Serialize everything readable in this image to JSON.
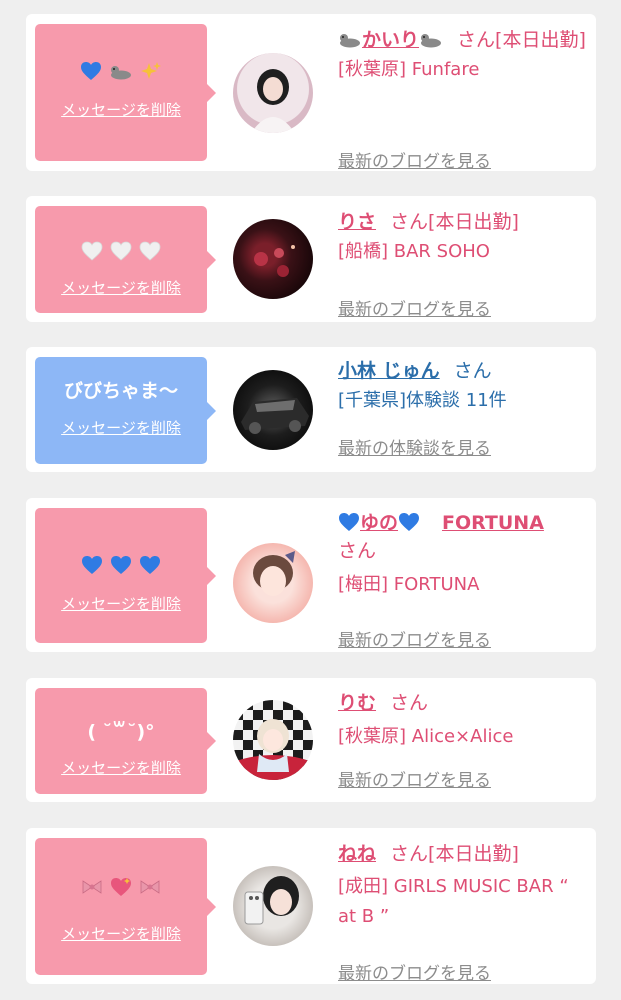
{
  "colors": {
    "pink_bubble": "#f79aac",
    "blue_bubble": "#8db7f6",
    "name_pink": "#de4e74",
    "name_blue": "#2b6eaa",
    "link_gray": "#8c8c8c",
    "heart_blue": "#2f7be3",
    "heart_white": "#f0f0f0",
    "heart_pink": "#e8567c"
  },
  "delete_label": "メッセージを削除",
  "entries": [
    {
      "message_icons": [
        "blue-heart-icon",
        "seal-icon",
        "sparkles-icon"
      ],
      "name": "かいり",
      "name_icons": [
        "seal-icon",
        "seal-icon"
      ],
      "san": "さん",
      "status": "[本日出勤]",
      "shop": "[秋葉原] Funfare",
      "link": "最新のブログを見る"
    },
    {
      "message_icons": [
        "white-heart-icon",
        "white-heart-icon",
        "white-heart-icon"
      ],
      "name": "りさ",
      "san": "さん",
      "status": "[本日出勤]",
      "shop": "[船橋] BAR SOHO",
      "link": "最新のブログを見る"
    },
    {
      "message": "びびちゃま〜",
      "name": "小林 じゅん",
      "san": "さん",
      "shop": "[千葉県]体験談 11件",
      "link": "最新の体験談を見る"
    },
    {
      "message_icons": [
        "blue-heart-icon",
        "blue-heart-icon",
        "blue-heart-icon"
      ],
      "name": "ゆの",
      "name_icons": [
        "blue-heart-icon",
        "blue-heart-icon"
      ],
      "name_suffix": "FORTUNA",
      "san": "さん",
      "shop": "[梅田] FORTUNA",
      "link": "最新のブログを見る"
    },
    {
      "message": "( ˘꒳˘)°",
      "name": "りむ",
      "san": "さん",
      "shop": "[秋葉原] Alice×Alice",
      "link": "最新のブログを見る"
    },
    {
      "message_icons": [
        "ribbon-icon",
        "sparkling-heart-icon",
        "ribbon-icon"
      ],
      "name": "ねね",
      "san": "さん",
      "status": "[本日出勤]",
      "shop": "[成田] GIRLS MUSIC BAR “ at B ”",
      "link": "最新のブログを見る"
    }
  ]
}
